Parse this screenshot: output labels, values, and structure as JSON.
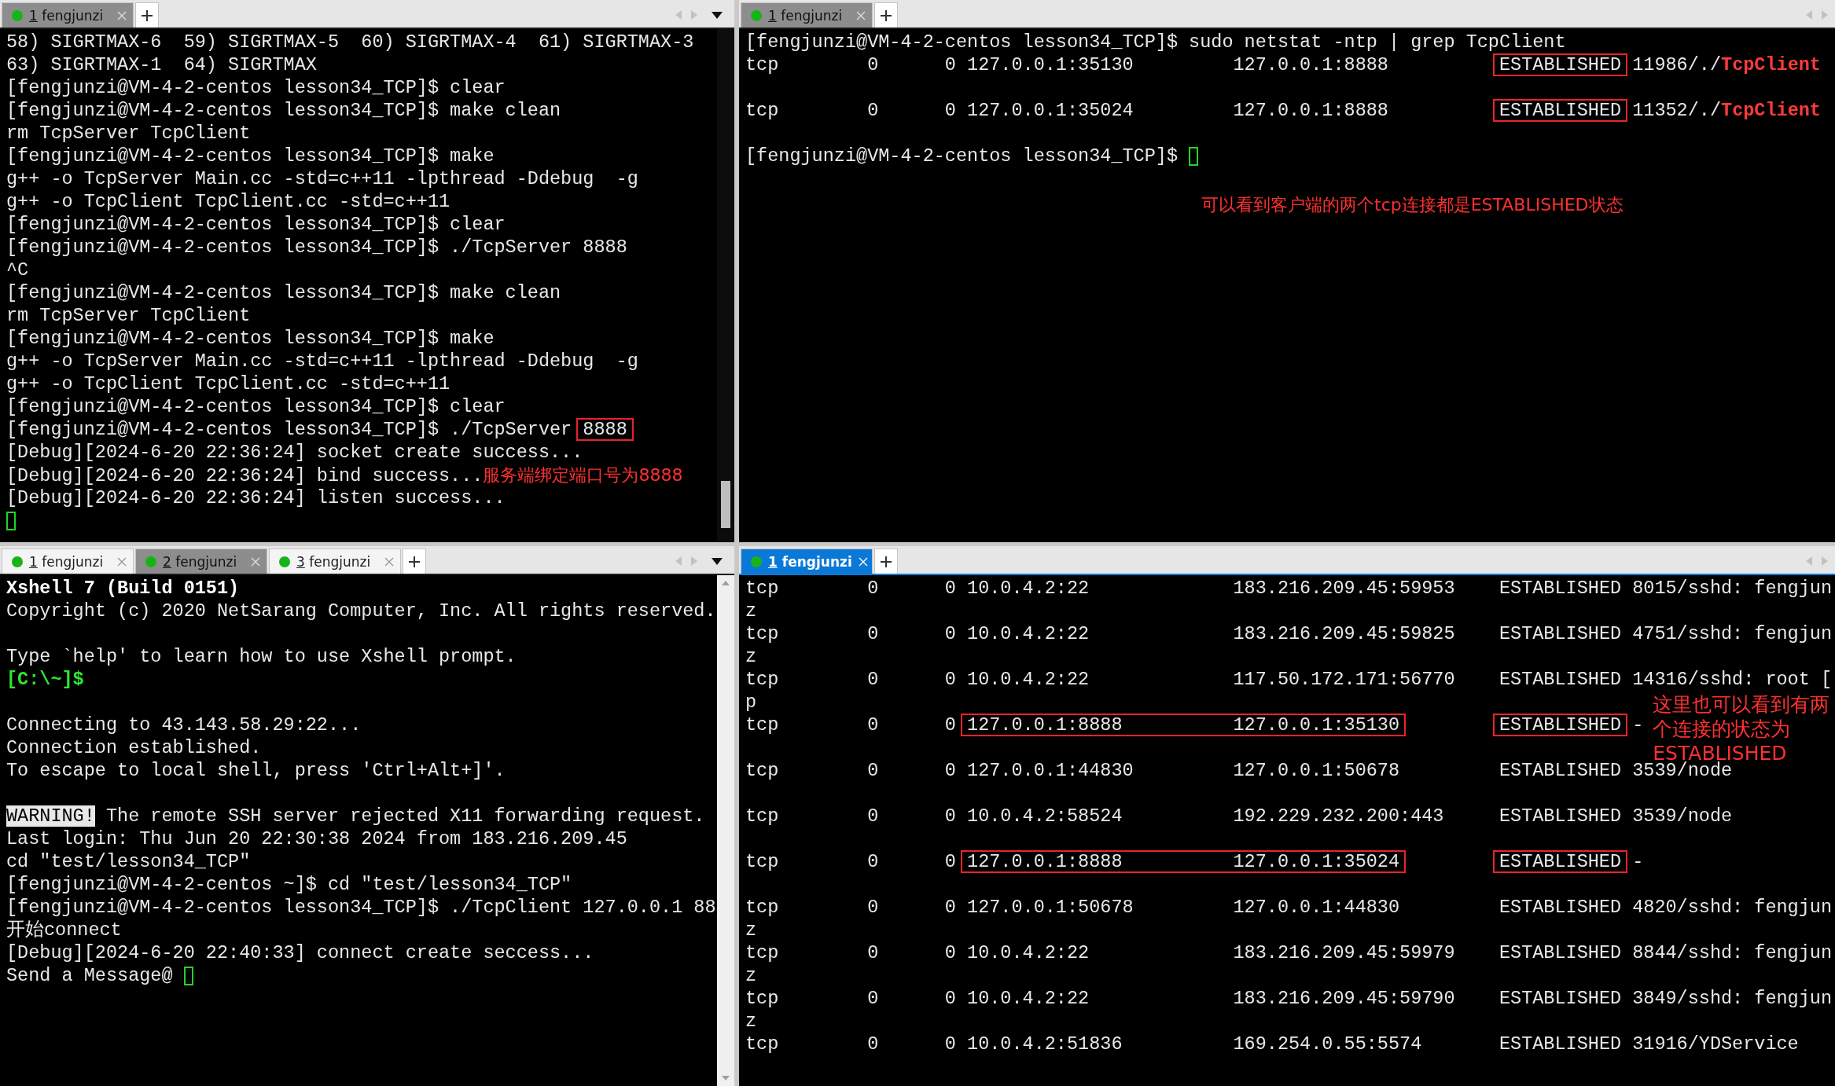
{
  "panes": [
    {
      "focused": false,
      "tabs": [
        {
          "number": "1",
          "label": "fengjunzi",
          "selected": true
        }
      ],
      "lines": [
        {
          "segments": [
            {
              "kind": "plain",
              "text": "58) SIGRTMAX-6  59) SIGRTMAX-5  60) SIGRTMAX-4  61) SIGRTMAX-3"
            }
          ]
        },
        {
          "segments": [
            {
              "kind": "plain",
              "text": "63) SIGRTMAX-1  64) SIGRTMAX"
            }
          ]
        },
        {
          "segments": [
            {
              "kind": "plain",
              "text": "[fengjunzi@VM-4-2-centos lesson34_TCP]$ clear"
            }
          ]
        },
        {
          "segments": [
            {
              "kind": "plain",
              "text": "[fengjunzi@VM-4-2-centos lesson34_TCP]$ make clean"
            }
          ]
        },
        {
          "segments": [
            {
              "kind": "plain",
              "text": "rm TcpServer TcpClient"
            }
          ]
        },
        {
          "segments": [
            {
              "kind": "plain",
              "text": "[fengjunzi@VM-4-2-centos lesson34_TCP]$ make"
            }
          ]
        },
        {
          "segments": [
            {
              "kind": "plain",
              "text": "g++ -o TcpServer Main.cc -std=c++11 -lpthread -Ddebug  -g"
            }
          ]
        },
        {
          "segments": [
            {
              "kind": "plain",
              "text": "g++ -o TcpClient TcpClient.cc -std=c++11"
            }
          ]
        },
        {
          "segments": [
            {
              "kind": "plain",
              "text": "[fengjunzi@VM-4-2-centos lesson34_TCP]$ clear"
            }
          ]
        },
        {
          "segments": [
            {
              "kind": "plain",
              "text": "[fengjunzi@VM-4-2-centos lesson34_TCP]$ ./TcpServer 8888"
            }
          ]
        },
        {
          "segments": [
            {
              "kind": "plain",
              "text": "^C"
            }
          ]
        },
        {
          "segments": [
            {
              "kind": "plain",
              "text": "[fengjunzi@VM-4-2-centos lesson34_TCP]$ make clean"
            }
          ]
        },
        {
          "segments": [
            {
              "kind": "plain",
              "text": "rm TcpServer TcpClient"
            }
          ]
        },
        {
          "segments": [
            {
              "kind": "plain",
              "text": "[fengjunzi@VM-4-2-centos lesson34_TCP]$ make"
            }
          ]
        },
        {
          "segments": [
            {
              "kind": "plain",
              "text": "g++ -o TcpServer Main.cc -std=c++11 -lpthread -Ddebug  -g"
            }
          ]
        },
        {
          "segments": [
            {
              "kind": "plain",
              "text": "g++ -o TcpClient TcpClient.cc -std=c++11"
            }
          ]
        },
        {
          "segments": [
            {
              "kind": "plain",
              "text": "[fengjunzi@VM-4-2-centos lesson34_TCP]$ clear"
            }
          ]
        },
        {
          "segments": [
            {
              "kind": "plain",
              "text": "[fengjunzi@VM-4-2-centos lesson34_TCP]$ ./TcpServer "
            },
            {
              "kind": "boxed",
              "text": "8888"
            }
          ]
        },
        {
          "segments": [
            {
              "kind": "plain",
              "text": "[Debug][2024-6-20 22:36:24] socket create success..."
            }
          ]
        },
        {
          "segments": [
            {
              "kind": "plain",
              "text": "[Debug][2024-6-20 22:36:24] bind success..."
            },
            {
              "kind": "note",
              "text": "服务端绑定端口号为8888"
            }
          ]
        },
        {
          "segments": [
            {
              "kind": "plain",
              "text": "[Debug][2024-6-20 22:36:24] listen success..."
            }
          ]
        },
        {
          "segments": [
            {
              "kind": "cursor"
            }
          ]
        }
      ]
    },
    {
      "focused": false,
      "tabs": [
        {
          "number": "1",
          "label": "fengjunzi",
          "selected": true
        }
      ],
      "lines": [
        {
          "segments": [
            {
              "kind": "plain",
              "text": "[fengjunzi@VM-4-2-centos lesson34_TCP]$ sudo netstat -ntp | grep TcpClient"
            }
          ]
        },
        {
          "segments": [
            {
              "kind": "plain",
              "text": "tcp        0      0 127.0.0.1:35130         127.0.0.1:8888          "
            },
            {
              "kind": "boxed",
              "text": "ESTABLISHED"
            },
            {
              "kind": "plain",
              "text": " 11986/./"
            },
            {
              "kind": "red",
              "text": "TcpClient"
            }
          ]
        },
        {
          "kind": "blank"
        },
        {
          "segments": [
            {
              "kind": "plain",
              "text": "tcp        0      0 127.0.0.1:35024         127.0.0.1:8888          "
            },
            {
              "kind": "boxed",
              "text": "ESTABLISHED"
            },
            {
              "kind": "plain",
              "text": " 11352/./"
            },
            {
              "kind": "red",
              "text": "TcpClient"
            }
          ]
        },
        {
          "kind": "blank"
        },
        {
          "segments": [
            {
              "kind": "plain",
              "text": "[fengjunzi@VM-4-2-centos lesson34_TCP]$ "
            },
            {
              "kind": "cursor"
            }
          ]
        },
        {
          "kind": "blank"
        },
        {
          "segments": [
            {
              "kind": "note",
              "text": "可以看到客户端的两个tcp连接都是ESTABLISHED状态"
            }
          ]
        }
      ]
    },
    {
      "focused": false,
      "tabs": [
        {
          "number": "1",
          "label": "fengjunzi",
          "selected": false
        },
        {
          "number": "2",
          "label": "fengjunzi",
          "selected": true
        },
        {
          "number": "3",
          "label": "fengjunzi",
          "selected": false
        }
      ],
      "lines": [
        {
          "segments": [
            {
              "kind": "bold",
              "text": "Xshell 7 (Build 0151)"
            }
          ]
        },
        {
          "segments": [
            {
              "kind": "plain",
              "text": "Copyright (c) 2020 NetSarang Computer, Inc. All rights reserved."
            }
          ]
        },
        {
          "kind": "blank"
        },
        {
          "segments": [
            {
              "kind": "plain",
              "text": "Type `help' to learn how to use Xshell prompt."
            }
          ]
        },
        {
          "segments": [
            {
              "kind": "prompt",
              "text": "[C:\\~]$"
            }
          ]
        },
        {
          "kind": "blank"
        },
        {
          "segments": [
            {
              "kind": "plain",
              "text": "Connecting to 43.143.58.29:22..."
            }
          ]
        },
        {
          "segments": [
            {
              "kind": "plain",
              "text": "Connection established."
            }
          ]
        },
        {
          "segments": [
            {
              "kind": "plain",
              "text": "To escape to local shell, press 'Ctrl+Alt+]'."
            }
          ]
        },
        {
          "kind": "blank"
        },
        {
          "segments": [
            {
              "kind": "inverse",
              "text": "WARNING!"
            },
            {
              "kind": "plain",
              "text": " The remote SSH server rejected X11 forwarding request."
            }
          ]
        },
        {
          "segments": [
            {
              "kind": "plain",
              "text": "Last login: Thu Jun 20 22:30:38 2024 from 183.216.209.45"
            }
          ]
        },
        {
          "segments": [
            {
              "kind": "plain",
              "text": "cd \"test/lesson34_TCP\""
            }
          ]
        },
        {
          "segments": [
            {
              "kind": "plain",
              "text": "[fengjunzi@VM-4-2-centos ~]$ cd \"test/lesson34_TCP\""
            }
          ]
        },
        {
          "segments": [
            {
              "kind": "plain",
              "text": "[fengjunzi@VM-4-2-centos lesson34_TCP]$ ./TcpClient 127.0.0.1 88"
            }
          ]
        },
        {
          "segments": [
            {
              "kind": "plain",
              "text": "开始connect"
            }
          ]
        },
        {
          "segments": [
            {
              "kind": "plain",
              "text": "[Debug][2024-6-20 22:40:33] connect create seccess..."
            }
          ]
        },
        {
          "segments": [
            {
              "kind": "plain",
              "text": "Send a Message@ "
            },
            {
              "kind": "cursor"
            }
          ]
        }
      ]
    },
    {
      "focused": true,
      "tabs": [
        {
          "number": "1",
          "label": "fengjunzi",
          "selected": true
        }
      ],
      "lines": [
        {
          "segments": [
            {
              "kind": "plain",
              "text": "tcp        0      0 10.0.4.2:22             183.216.209.45:59953    ESTABLISHED 8015/sshd: fengjun"
            }
          ]
        },
        {
          "segments": [
            {
              "kind": "plain",
              "text": "z"
            }
          ]
        },
        {
          "segments": [
            {
              "kind": "plain",
              "text": "tcp        0      0 10.0.4.2:22             183.216.209.45:59825    ESTABLISHED 4751/sshd: fengjun"
            }
          ]
        },
        {
          "segments": [
            {
              "kind": "plain",
              "text": "z"
            }
          ]
        },
        {
          "segments": [
            {
              "kind": "plain",
              "text": "tcp        0      0 10.0.4.2:22             117.50.172.171:56770    ESTABLISHED 14316/sshd: root ["
            }
          ]
        },
        {
          "segments": [
            {
              "kind": "plain",
              "text": "p"
            }
          ]
        },
        {
          "segments": [
            {
              "kind": "plain",
              "text": "tcp        0      0 "
            },
            {
              "kind": "boxed",
              "text": "127.0.0.1:8888          127.0.0.1:35130"
            },
            {
              "kind": "gap"
            },
            {
              "kind": "boxed",
              "text": "ESTABLISHED"
            },
            {
              "kind": "plain",
              "text": " -"
            },
            {
              "kind": "callout",
              "text": "这里也可以看到有两个连接的状态为ESTABLISHED"
            }
          ]
        },
        {
          "kind": "blank"
        },
        {
          "segments": [
            {
              "kind": "plain",
              "text": "tcp        0      0 127.0.0.1:44830         127.0.0.1:50678         ESTABLISHED 3539/node"
            }
          ]
        },
        {
          "kind": "blank"
        },
        {
          "segments": [
            {
              "kind": "plain",
              "text": "tcp        0      0 10.0.4.2:58524          192.229.232.200:443     ESTABLISHED 3539/node"
            }
          ]
        },
        {
          "kind": "blank"
        },
        {
          "segments": [
            {
              "kind": "plain",
              "text": "tcp        0      0 "
            },
            {
              "kind": "boxed",
              "text": "127.0.0.1:8888          127.0.0.1:35024"
            },
            {
              "kind": "gap"
            },
            {
              "kind": "boxed",
              "text": "ESTABLISHED"
            },
            {
              "kind": "plain",
              "text": " -"
            }
          ]
        },
        {
          "kind": "blank"
        },
        {
          "segments": [
            {
              "kind": "plain",
              "text": "tcp        0      0 127.0.0.1:50678         127.0.0.1:44830         ESTABLISHED 4820/sshd: fengjun"
            }
          ]
        },
        {
          "segments": [
            {
              "kind": "plain",
              "text": "z"
            }
          ]
        },
        {
          "segments": [
            {
              "kind": "plain",
              "text": "tcp        0      0 10.0.4.2:22             183.216.209.45:59979    ESTABLISHED 8844/sshd: fengjun"
            }
          ]
        },
        {
          "segments": [
            {
              "kind": "plain",
              "text": "z"
            }
          ]
        },
        {
          "segments": [
            {
              "kind": "plain",
              "text": "tcp        0      0 10.0.4.2:22             183.216.209.45:59790    ESTABLISHED 3849/sshd: fengjun"
            }
          ]
        },
        {
          "segments": [
            {
              "kind": "plain",
              "text": "z"
            }
          ]
        },
        {
          "segments": [
            {
              "kind": "plain",
              "text": "tcp        0      0 10.0.4.2:51836          169.254.0.55:5574       ESTABLISHED 31916/YDService"
            }
          ]
        }
      ]
    }
  ]
}
